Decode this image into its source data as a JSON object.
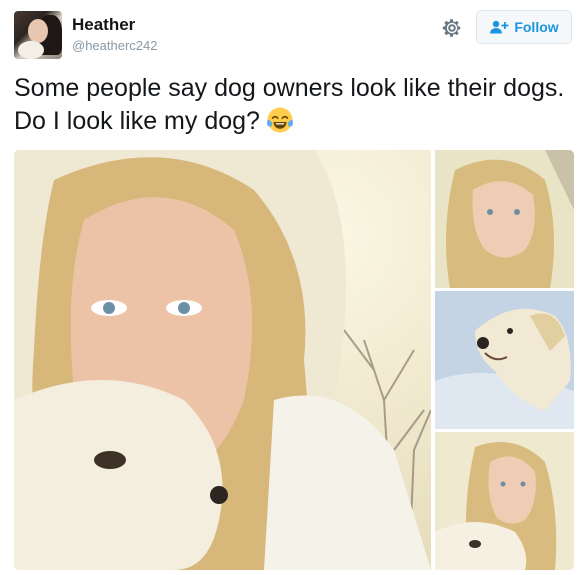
{
  "user": {
    "display_name": "Heather",
    "handle": "@heatherc242",
    "avatar_icon": "profile-photo-woman-with-dog"
  },
  "actions": {
    "settings_icon": "gear-icon",
    "follow_label": "Follow",
    "follow_icon": "add-user-icon"
  },
  "tweet": {
    "text": "Some people say dog owners look like their dogs. Do I look like my dog?",
    "emoji": "face-with-tears-of-joy"
  },
  "media": {
    "photos": [
      {
        "description_icon": "selfie-woman-with-dog-photo"
      },
      {
        "description_icon": "selfie-woman-photo"
      },
      {
        "description_icon": "golden-retriever-in-snow-photo"
      },
      {
        "description_icon": "selfie-woman-with-dog-photo"
      }
    ]
  },
  "colors": {
    "name": "#14171a",
    "handle": "#8899a6",
    "follow_accent": "#1b95e0",
    "follow_bg": "#f5f8fa",
    "follow_border": "#e1e8ed"
  }
}
